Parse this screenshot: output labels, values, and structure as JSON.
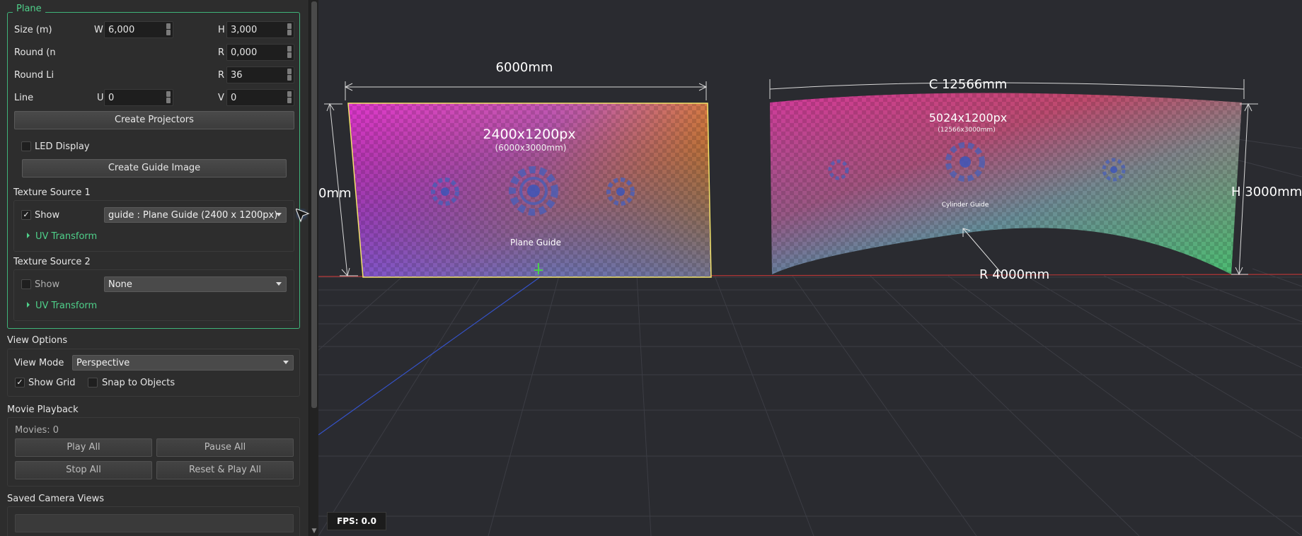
{
  "plane": {
    "group_title": "Plane",
    "size_label": "Size (m)",
    "w_label": "W",
    "w_value": "6,000",
    "h_label": "H",
    "h_value": "3,000",
    "round_n_label": "Round (n",
    "r_label": "R",
    "r_value": "0,000",
    "round_li_label": "Round Li",
    "r2_value": "36",
    "line_label": "Line",
    "u_label": "U",
    "u_value": "0",
    "v_label": "V",
    "v_value": "0",
    "create_projectors": "Create Projectors",
    "led_display": "LED Display",
    "create_guide_image": "Create Guide Image",
    "tex1_title": "Texture Source 1",
    "tex1_show": "Show",
    "tex1_value": "guide : Plane Guide (2400 x 1200px)",
    "tex1_uv": "UV Transform",
    "tex2_title": "Texture Source 2",
    "tex2_show": "Show",
    "tex2_value": "None",
    "tex2_uv": "UV Transform"
  },
  "view_options": {
    "title": "View Options",
    "view_mode_label": "View Mode",
    "view_mode_value": "Perspective",
    "show_grid": "Show Grid",
    "snap_to_objects": "Snap to Objects"
  },
  "movie": {
    "title": "Movie Playback",
    "movies": "Movies: 0",
    "play_all": "Play All",
    "pause_all": "Pause All",
    "stop_all": "Stop All",
    "reset_play_all": "Reset & Play All"
  },
  "saved_camera": {
    "title": "Saved Camera Views"
  },
  "viewport": {
    "plane_width": "6000mm",
    "plane_height_partial": "0mm",
    "plane_px": "2400x1200px",
    "plane_mm": "(6000x3000mm)",
    "plane_guide": "Plane Guide",
    "cyl_circ": "C 12566mm",
    "cyl_px": "5024x1200px",
    "cyl_mm": "(12566x3000mm)",
    "cyl_guide": "Cylinder Guide",
    "cyl_height": "H 3000mm",
    "cyl_radius": "R 4000mm",
    "fps": "FPS: 0.0"
  },
  "colors": {
    "accent": "#4fd08a",
    "panel": "#2d2d2d",
    "viewport": "#2a2b30"
  }
}
